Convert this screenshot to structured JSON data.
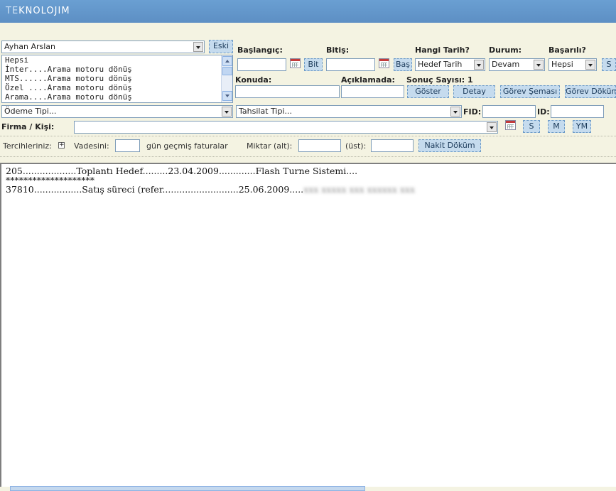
{
  "header": {
    "logo_prefix": "TE",
    "logo_rest": "KNOLOJIM"
  },
  "filters": {
    "user_select": "Ayhan Arslan",
    "eski_button": "Eski",
    "listbox_items": [
      "Hepsi",
      "İnter....Arama motoru dönüş",
      "MTS......Arama motoru dönüş",
      "Özel ....Arama motoru dönüş",
      "Arama....Arama motoru dönüş"
    ],
    "baslangic_label": "Başlangıç:",
    "bitis_label": "Bitiş:",
    "bit_button": "Bit",
    "bas_button": "Baş",
    "hangi_tarih_label": "Hangi Tarih?",
    "hangi_tarih_value": "Hedef Tarih",
    "durum_label": "Durum:",
    "durum_value": "Devam",
    "basarili_label": "Başarılı?",
    "basarili_value": "Hepsi",
    "s_button_top": "S",
    "konuda_label": "Konuda:",
    "aciklamada_label": "Açıklamada:",
    "sonuc_sayisi_label": "Sonuç Sayısı: 1",
    "goster_button": "Göster",
    "detay_button": "Detay",
    "gorev_semasi_button": "Görev Şeması",
    "gorev_dokum_button": "Görev Döküm",
    "odeme_tipi": "Ödeme Tipi...",
    "tahsilat_tipi": "Tahsilat Tipi...",
    "fid_label": "FID:",
    "id_label": "ID:",
    "firma_kisi_label": "Firma / Kişi:",
    "firma_kisi_value": "",
    "s_button": "S",
    "m_button": "M",
    "ym_button": "YM"
  },
  "prefs": {
    "tercihleriniz_label": "Tercihleriniz:",
    "plus_sign": "+",
    "vadesini_label": "Vadesini:",
    "gun_gecmis_label": "gün geçmiş faturalar",
    "miktar_alt_label": "Miktar (alt):",
    "ust_label": "(üst):",
    "nakit_dokum_button": "Nakit Döküm"
  },
  "output": {
    "line1": "205...................Toplantı Hedef.........23.04.2009.............Flash Turne Sistemi....",
    "line2": "********************",
    "line3_visible": "37810.................Satış süreci (refer...........................25.06.2009.....",
    "line3_blurred": "xxx xxxxx xxx xxxxxx xxx"
  }
}
